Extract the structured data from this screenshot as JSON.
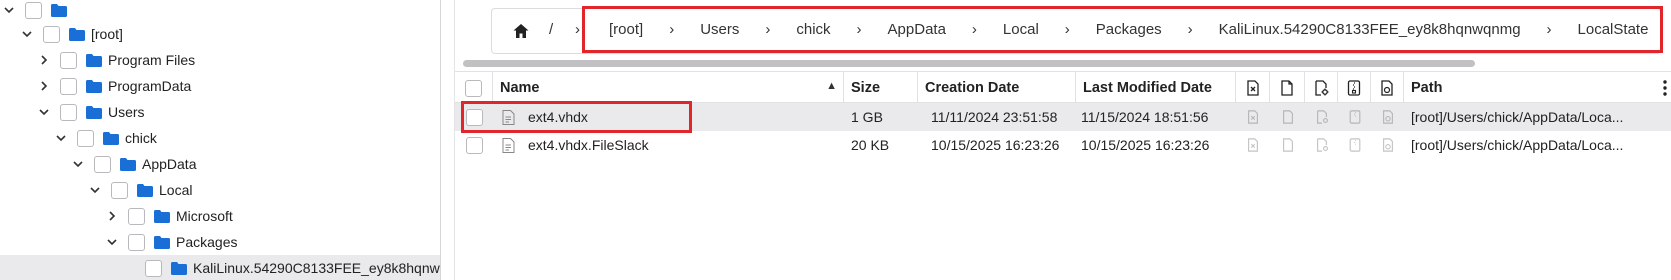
{
  "tree": {
    "items": [
      {
        "label": "",
        "expanded": true
      },
      {
        "label": "[root]",
        "expanded": true
      },
      {
        "label": "Program Files",
        "expanded": false
      },
      {
        "label": "ProgramData",
        "expanded": false
      },
      {
        "label": "Users",
        "expanded": true
      },
      {
        "label": "chick",
        "expanded": true
      },
      {
        "label": "AppData",
        "expanded": true
      },
      {
        "label": "Local",
        "expanded": true
      },
      {
        "label": "Microsoft",
        "expanded": false
      },
      {
        "label": "Packages",
        "expanded": true
      },
      {
        "label": "KaliLinux.54290C8133FEE_ey8k8hqnw",
        "selected": true
      }
    ]
  },
  "breadcrumb": {
    "root_sep": "/",
    "partial": "›",
    "items": [
      "[root]",
      "Users",
      "chick",
      "AppData",
      "Local",
      "Packages",
      "KaliLinux.54290C8133FEE_ey8k8hqnwqnmg",
      "LocalState"
    ],
    "arrow": "›"
  },
  "table": {
    "columns": {
      "name": "Name",
      "size": "Size",
      "created": "Creation Date",
      "modified": "Last Modified Date",
      "path": "Path"
    },
    "icon_columns": [
      "file-x-icon",
      "file-icon",
      "file-gear-icon",
      "file-zip-icon",
      "file-media-icon"
    ],
    "sort_indicator": "▲",
    "rows": [
      {
        "name": "ext4.vhdx",
        "size": "1 GB",
        "created": "11/11/2024 23:51:58",
        "modified": "11/15/2024 18:51:56",
        "path": "[root]/Users/chick/AppData/Loca..."
      },
      {
        "name": "ext4.vhdx.FileSlack",
        "size": "20 KB",
        "created": "10/15/2025 16:23:26",
        "modified": "10/15/2025 16:23:26",
        "path": "[root]/Users/chick/AppData/Loca..."
      }
    ]
  },
  "colors": {
    "folder": "#1a6fd6",
    "highlight_box": "#e0262b",
    "selected_row": "#eaeaec"
  }
}
